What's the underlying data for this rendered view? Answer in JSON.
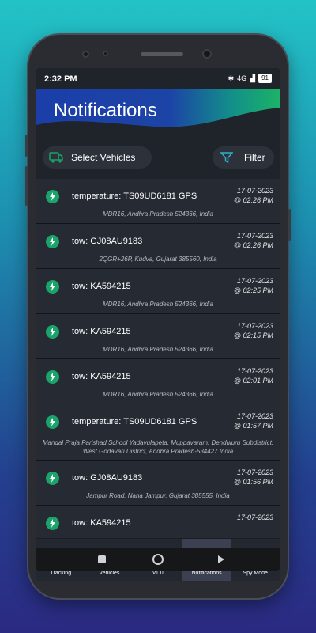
{
  "status_bar": {
    "time": "2:32 PM",
    "battery": "91",
    "network": "4G"
  },
  "header": {
    "title": "Notifications"
  },
  "toolbar": {
    "select_label": "Select Vehicles",
    "filter_label": "Filter"
  },
  "notifications": [
    {
      "title": "temperature: TS09UD6181 GPS",
      "date": "17-07-2023",
      "time": "@ 02:26 PM",
      "address": "MDR16, Andhra Pradesh 524366, India"
    },
    {
      "title": "tow: GJ08AU9183",
      "date": "17-07-2023",
      "time": "@ 02:26 PM",
      "address": "2QGR+26P, Kudva, Gujarat 385560, India"
    },
    {
      "title": "tow: KA594215",
      "date": "17-07-2023",
      "time": "@ 02:25 PM",
      "address": "MDR16, Andhra Pradesh 524366, India"
    },
    {
      "title": "tow: KA594215",
      "date": "17-07-2023",
      "time": "@ 02:15 PM",
      "address": "MDR16, Andhra Pradesh 524366, India"
    },
    {
      "title": "tow: KA594215",
      "date": "17-07-2023",
      "time": "@ 02:01 PM",
      "address": "MDR16, Andhra Pradesh 524366, India"
    },
    {
      "title": "temperature: TS09UD6181 GPS",
      "date": "17-07-2023",
      "time": "@ 01:57 PM",
      "address": "Mandal Praja Parishad School Yadavulapeta, Muppavaram, Denduluru Subdistrict, West Godavari District, Andhra Pradesh-534427 India"
    },
    {
      "title": "tow: GJ08AU9183",
      "date": "17-07-2023",
      "time": "@ 01:56 PM",
      "address": "Jampur Road, Nana Jampur, Gujarat 385555, India"
    },
    {
      "title": "tow: KA594215",
      "date": "17-07-2023",
      "time": "",
      "address": ""
    }
  ],
  "bottom_nav": [
    {
      "label": "Tracking",
      "icon": "home-icon"
    },
    {
      "label": "Vehicles",
      "icon": "vehicle-icon"
    },
    {
      "label": "v1.0",
      "icon": "menu-icon"
    },
    {
      "label": "Notifications",
      "icon": "bell-icon",
      "active": true
    },
    {
      "label": "Spy Mode",
      "icon": "eye-icon"
    }
  ],
  "colors": {
    "accent_green": "#1aa36a",
    "header_blue": "#1c3f9e",
    "header_teal": "#16b07a"
  }
}
